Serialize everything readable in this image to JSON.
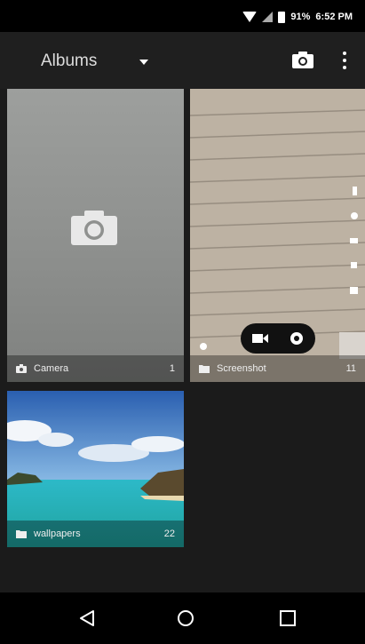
{
  "status_bar": {
    "battery": "91%",
    "time": "6:52 PM"
  },
  "toolbar": {
    "title": "Albums"
  },
  "albums": [
    {
      "name": "Camera",
      "count": "1",
      "icon": "camera-icon"
    },
    {
      "name": "Screenshot",
      "count": "11",
      "icon": "folder-icon"
    },
    {
      "name": "wallpapers",
      "count": "22",
      "icon": "folder-icon"
    }
  ],
  "colors": {
    "background": "#1b1b1b",
    "status_bar": "#000000",
    "toolbar": "#1f1f1f"
  }
}
